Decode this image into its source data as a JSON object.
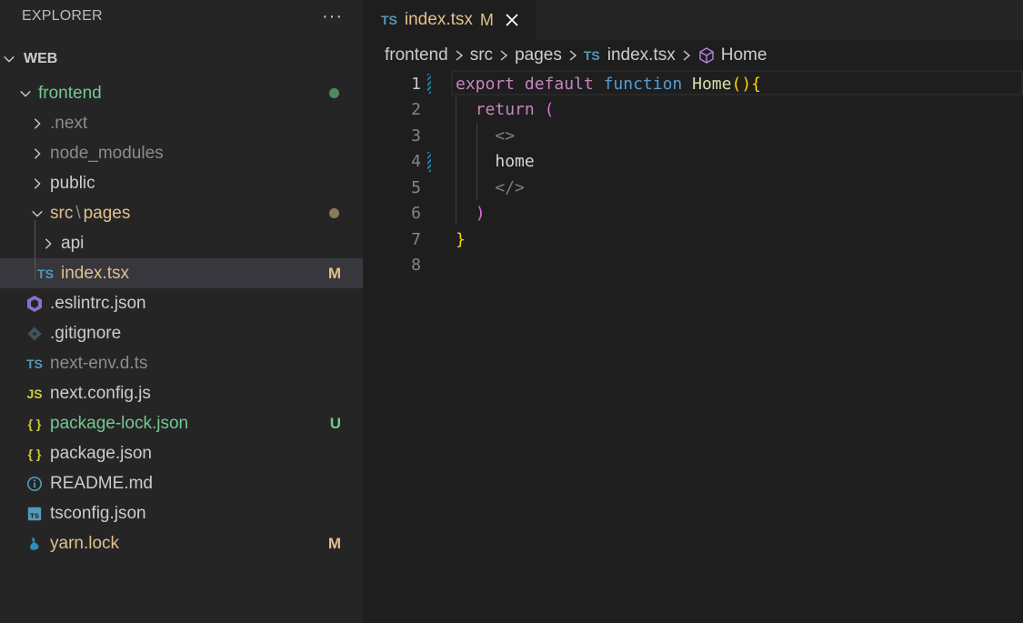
{
  "explorer": {
    "title": "EXPLORER",
    "more": "···",
    "root": "WEB",
    "items": [
      {
        "label": "frontend",
        "color": "#73c991"
      },
      {
        "label": ".next",
        "color": "#8c8c8c"
      },
      {
        "label": "node_modules",
        "color": "#8c8c8c"
      },
      {
        "label": "public",
        "color": "#cccccc"
      },
      {
        "label": "src",
        "label2": "pages",
        "color": "#e2c08d"
      },
      {
        "label": "api",
        "color": "#cccccc"
      },
      {
        "label": "index.tsx",
        "color": "#e2c08d",
        "badge": "M",
        "icon": "TS"
      },
      {
        "label": ".eslintrc.json",
        "color": "#cccccc"
      },
      {
        "label": ".gitignore",
        "color": "#cccccc"
      },
      {
        "label": "next-env.d.ts",
        "color": "#8c8c8c",
        "icon": "TS"
      },
      {
        "label": "next.config.js",
        "color": "#cccccc",
        "icon": "JS"
      },
      {
        "label": "package-lock.json",
        "color": "#73c991",
        "badge": "U",
        "icon": "{ }"
      },
      {
        "label": "package.json",
        "color": "#cccccc",
        "icon": "{ }"
      },
      {
        "label": "README.md",
        "color": "#cccccc"
      },
      {
        "label": "tsconfig.json",
        "color": "#cccccc",
        "icon": "TS"
      },
      {
        "label": "yarn.lock",
        "color": "#e2c08d",
        "badge": "M"
      }
    ],
    "src_sep": "\\"
  },
  "tab": {
    "icon": "TS",
    "name": "index.tsx",
    "status": "M"
  },
  "breadcrumb": {
    "parts": [
      "frontend",
      "src",
      "pages"
    ],
    "file_icon": "TS",
    "file": "index.tsx",
    "symbol": "Home"
  },
  "code": {
    "line_numbers": [
      "1",
      "2",
      "3",
      "4",
      "5",
      "6",
      "7",
      "8"
    ],
    "l1": {
      "a": "export",
      "b": "default",
      "c": "function",
      "d": "Home",
      "e": "()",
      "f": "{"
    },
    "l2": {
      "a": "return",
      "b": "("
    },
    "l3": "<>",
    "l4": "home",
    "l5": "</>",
    "l6": ")",
    "l7": "}"
  }
}
